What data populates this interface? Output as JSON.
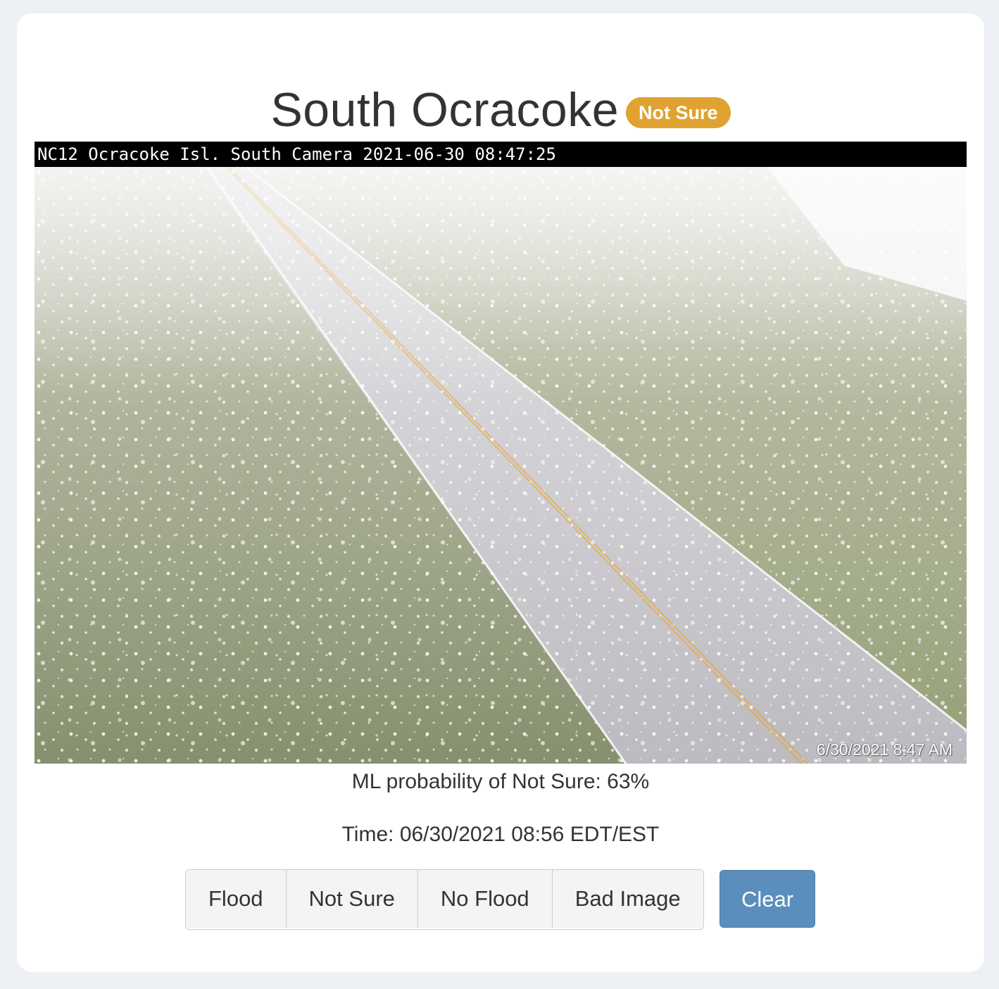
{
  "page": {
    "title": "South Ocracoke",
    "status_badge": "Not Sure",
    "badge_color": "#e0a230"
  },
  "camera": {
    "header_text": "NC12 Ocracoke Isl. South Camera 2021-06-30 08:47:25",
    "timestamp_overlay": "6/30/2021 8:47 AM"
  },
  "info": {
    "probability": "ML probability of Not Sure: 63%",
    "time": "Time: 06/30/2021 08:56 EDT/EST"
  },
  "buttons": {
    "flood": "Flood",
    "not_sure": "Not Sure",
    "no_flood": "No Flood",
    "bad_image": "Bad Image",
    "clear": "Clear",
    "clear_color": "#5b8ebd"
  }
}
